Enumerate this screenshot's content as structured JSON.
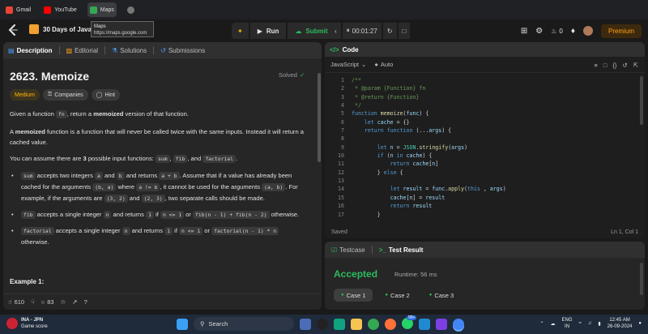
{
  "bookmarks": [
    {
      "label": "Gmail",
      "color": "#ea4335"
    },
    {
      "label": "YouTube",
      "color": "#ff0000"
    },
    {
      "label": "Maps",
      "color": "#34a853"
    }
  ],
  "tooltip": {
    "title": "Maps",
    "url": "https://maps.google.com"
  },
  "header": {
    "problem_list": "30 Days of JavaSc",
    "run": "Run",
    "submit": "Submit",
    "timer": "00:01:27",
    "streak": "0",
    "premium": "Premium"
  },
  "left_tabs": [
    "Description",
    "Editorial",
    "Solutions",
    "Submissions"
  ],
  "problem": {
    "title": "2623. Memoize",
    "solved": "Solved",
    "tags": [
      "Medium",
      "Companies",
      "Hint"
    ],
    "intro": [
      "Given a function ",
      "fn",
      ", return a ",
      "memoized",
      " version of that function."
    ],
    "memo_def": [
      "A ",
      "memoized",
      " function is a function that will never be called twice with the same inputs. Instead it will return a cached value."
    ],
    "assume": [
      "You can assume there are ",
      "3",
      " possible input functions: ",
      "sum",
      ", ",
      "fib",
      ", and ",
      "factorial",
      "."
    ],
    "bullet1": [
      "sum",
      " accepts two integers ",
      "a",
      " and ",
      "b",
      " and returns ",
      "a + b",
      ". Assume that if a value has already been cached for the arguments ",
      "(b, a)",
      " where ",
      "a != b",
      ", it cannot be used for the arguments ",
      "(a, b)",
      ". For example, if the arguments are ",
      "(3, 2)",
      " and ",
      "(2, 3)",
      ", two separate calls should be made."
    ],
    "bullet2": [
      "fib",
      " accepts a single integer ",
      "n",
      " and returns ",
      "1",
      " if ",
      "n <= 1",
      " or ",
      "fib(n - 1) + fib(n - 2)",
      " otherwise."
    ],
    "bullet3": [
      "factorial",
      " accepts a single integer ",
      "n",
      " and returns ",
      "1",
      " if ",
      "n <= 1",
      " or ",
      "factorial(n - 1) * n",
      " otherwise."
    ],
    "example": "Example 1:"
  },
  "left_footer": {
    "likes": "610",
    "comments": "83"
  },
  "code_panel": {
    "tab": "Code",
    "language": "JavaScript",
    "mode": "Auto",
    "line_numbers": [
      "1",
      "2",
      "3",
      "4",
      "5",
      "6",
      "7",
      "8",
      "9",
      "10",
      "11",
      "12",
      "13",
      "14",
      "15",
      "16",
      "17"
    ],
    "status_left": "Saved",
    "status_right": "Ln 1, Col 1"
  },
  "result_panel": {
    "tabs": [
      "Testcase",
      "Test Result"
    ],
    "status": "Accepted",
    "runtime": "Runtime: 56 ms",
    "cases": [
      "Case 1",
      "Case 2",
      "Case 3"
    ]
  },
  "taskbar": {
    "weather_title": "INA - JPN",
    "weather_sub": "Game score",
    "search": "Search",
    "badge": "99+",
    "lang_top": "ENG",
    "lang_bottom": "IN",
    "time": "12:45 AM",
    "date": "26-09-2024"
  }
}
